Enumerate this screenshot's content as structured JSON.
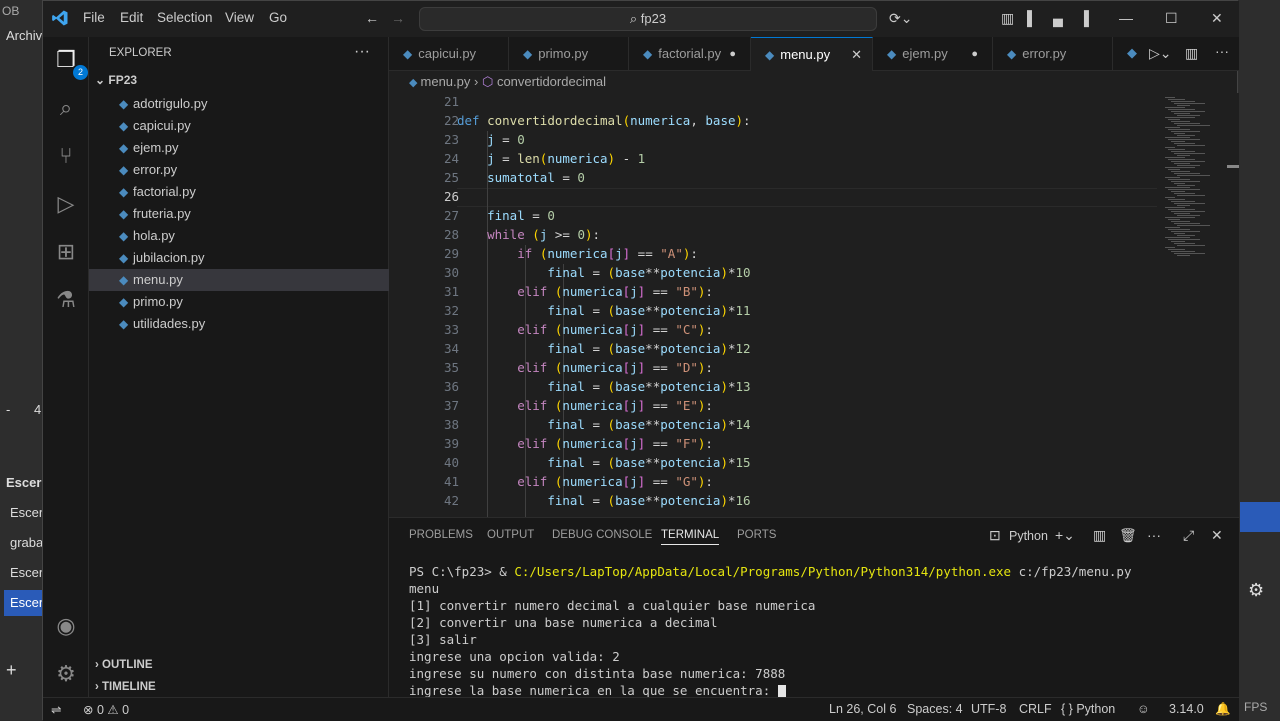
{
  "app": {
    "title_search": "fp23"
  },
  "menu": {
    "file": "File",
    "edit": "Edit",
    "selection": "Selection",
    "view": "View",
    "go": "Go"
  },
  "background": {
    "obs_title": "OB",
    "archivo": "Archiv",
    "esc1": "Escer",
    "esc2": "Escer",
    "grab": "graba",
    "esc3": "Escer",
    "esc4": "Escer",
    "fps": "FPS",
    "minus": "-",
    "four": "4"
  },
  "explorer": {
    "title": "EXPLORER",
    "folder": "FP23",
    "files": [
      "adotrigulo.py",
      "capicui.py",
      "ejem.py",
      "error.py",
      "factorial.py",
      "fruteria.py",
      "hola.py",
      "jubilacion.py",
      "menu.py",
      "primo.py",
      "utilidades.py"
    ],
    "outline": "OUTLINE",
    "timeline": "TIMELINE"
  },
  "tabs": [
    "capicui.py",
    "primo.py",
    "factorial.py",
    "menu.py",
    "ejem.py",
    "error.py"
  ],
  "breadcrumb": {
    "file": "menu.py",
    "symbol": "convertidordecimal"
  },
  "editor": {
    "line_numbers": [
      "21",
      "22",
      "23",
      "24",
      "25",
      "26",
      "27",
      "28",
      "29",
      "30",
      "31",
      "32",
      "33",
      "34",
      "35",
      "36",
      "37",
      "38",
      "39",
      "40",
      "41",
      "42"
    ]
  },
  "panel": {
    "tabs": [
      "PROBLEMS",
      "OUTPUT",
      "DEBUG CONSOLE",
      "TERMINAL",
      "PORTS"
    ],
    "shell": "Python",
    "prompt": "PS C:\\fp23> & ",
    "cmd": "C:/Users/LapTop/AppData/Local/Programs/Python/Python314/python.exe",
    "arg": " c:/fp23/menu.py",
    "lines": [
      "menu",
      "[1] convertir numero decimal a cualquier base numerica",
      "[2] convertir una base numerica a decimal",
      "[3] salir",
      "ingrese una opcion valida: 2",
      "ingrese su numero con distinta base numerica: 7888",
      "ingrese la base numerica en la que se encuentra: "
    ]
  },
  "status": {
    "errors": "0",
    "warnings": "0",
    "position": "Ln 26, Col 6",
    "spaces": "Spaces: 4",
    "encoding": "UTF-8",
    "eol": "CRLF",
    "language": "Python",
    "version": "3.14.0"
  },
  "badge": "2"
}
